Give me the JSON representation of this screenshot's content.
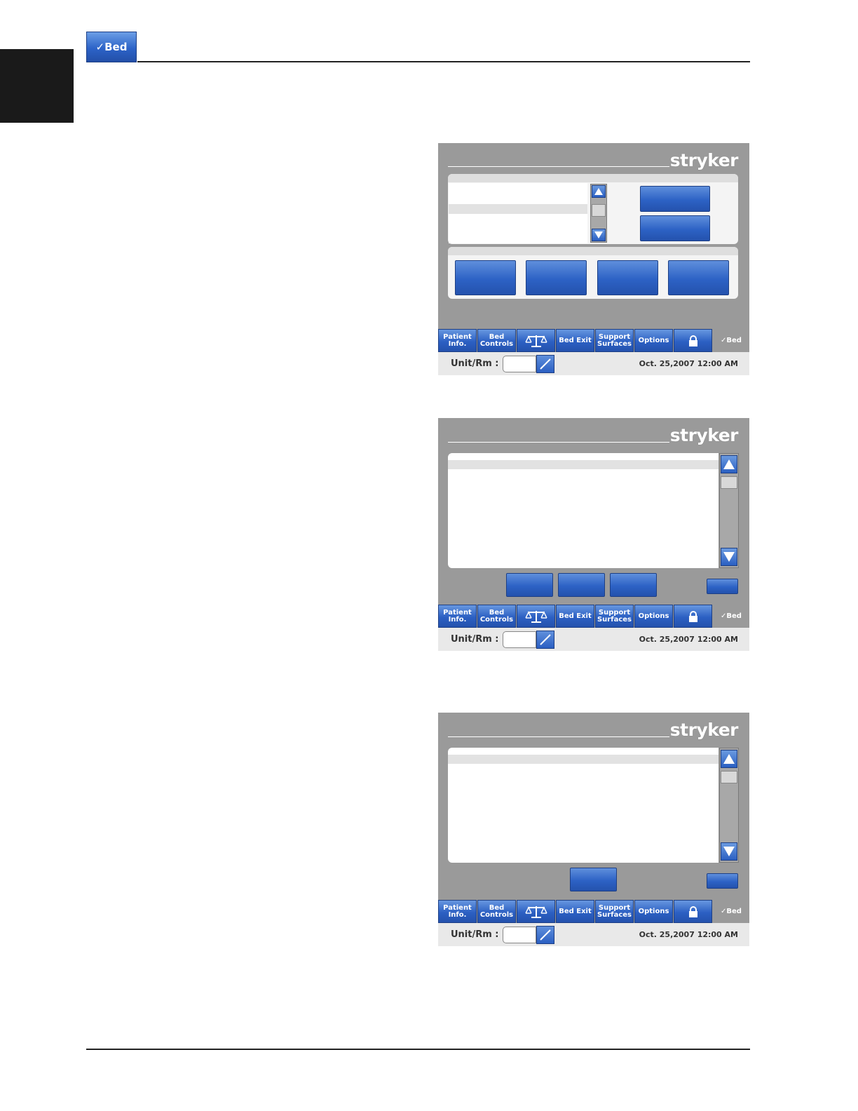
{
  "header": {
    "badge_label": "✓Bed"
  },
  "screens": [
    {
      "logo": "stryker",
      "navbar": [
        {
          "label": "Patient\nInfo."
        },
        {
          "label": "Bed\nControls"
        },
        {
          "icon": "scale-icon"
        },
        {
          "label": "Bed Exit"
        },
        {
          "label": "Support\nSurfaces"
        },
        {
          "label": "Options"
        },
        {
          "icon": "lock-icon"
        }
      ],
      "brand": "✓Bed",
      "unit_label": "Unit/Rm :",
      "datetime": "Oct. 25,2007  12:00 AM"
    },
    {
      "logo": "stryker",
      "navbar": [
        {
          "label": "Patient\nInfo."
        },
        {
          "label": "Bed\nControls"
        },
        {
          "icon": "scale-icon"
        },
        {
          "label": "Bed Exit"
        },
        {
          "label": "Support\nSurfaces"
        },
        {
          "label": "Options"
        },
        {
          "icon": "lock-icon"
        }
      ],
      "brand": "✓Bed",
      "unit_label": "Unit/Rm :",
      "datetime": "Oct. 25,2007  12:00 AM"
    },
    {
      "logo": "stryker",
      "navbar": [
        {
          "label": "Patient\nInfo."
        },
        {
          "label": "Bed\nControls"
        },
        {
          "icon": "scale-icon"
        },
        {
          "label": "Bed Exit"
        },
        {
          "label": "Support\nSurfaces"
        },
        {
          "label": "Options"
        },
        {
          "icon": "lock-icon"
        }
      ],
      "brand": "✓Bed",
      "unit_label": "Unit/Rm :",
      "datetime": "Oct. 25,2007  12:00 AM"
    }
  ],
  "colors": {
    "accent": "#2c60c3",
    "screen_bg": "#9a9a9a"
  }
}
